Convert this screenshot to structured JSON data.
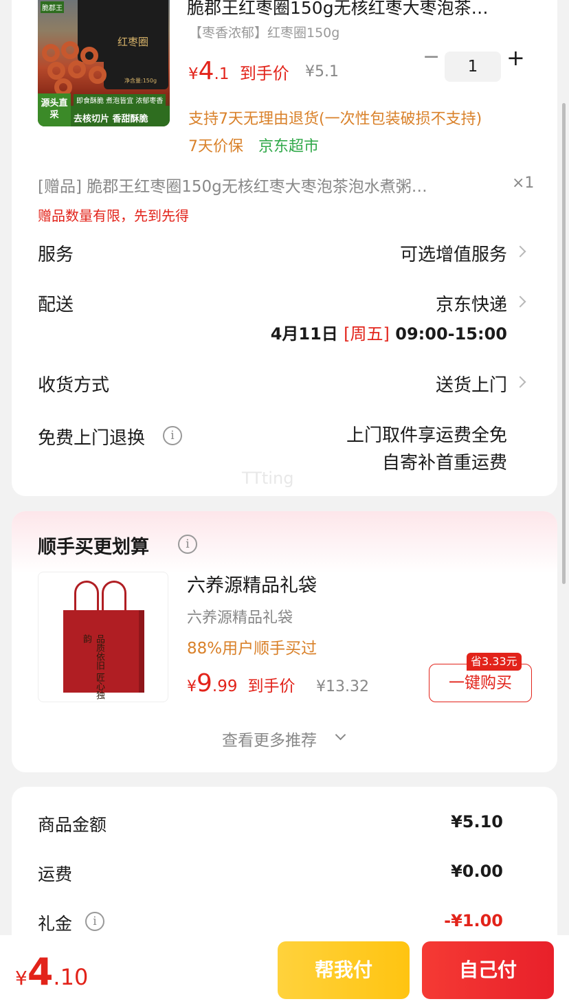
{
  "product": {
    "title": "脆郡王红枣圈150g无核红枣大枣泡茶…",
    "spec": "【枣香浓郁】红枣圈150g",
    "price_symbol": "¥",
    "price_int": "4",
    "price_dec": ".1",
    "price_suffix": "到手价",
    "original_price": "¥5.1",
    "quantity": "1",
    "minus": "−",
    "plus": "+",
    "return_policy": "支持7天无理由退货(一次性包装破损不支持)",
    "price_protect": "7天价保",
    "store_tag": "京东超市",
    "image": {
      "jar_label": "红枣圈",
      "brand": "脆郡王",
      "band_text": "去核切片 香甜酥脆",
      "tag_text": "源头直采",
      "strip_text": "即食酥脆 煮泡皆宜 浓郁枣香",
      "net_weight": "净含量:150g"
    }
  },
  "gift": {
    "text": "[赠品] 脆郡王红枣圈150g无核红枣大枣泡茶泡水煮粥…",
    "count": "×1",
    "notice": "赠品数量有限，先到先得"
  },
  "rows": {
    "service_label": "服务",
    "service_value": "可选增值服务",
    "delivery_label": "配送",
    "delivery_value": "京东快递",
    "delivery_date": "4月11日",
    "delivery_weekday": "[周五]",
    "delivery_time": "09:00-15:00",
    "receive_label": "收货方式",
    "receive_value": "送货上门",
    "return_label": "免费上门退换",
    "return_value_1": "上门取件享运费全免",
    "return_value_2": "自寄补首重运费",
    "info_glyph": "i"
  },
  "watermark": "TTting",
  "bundle": {
    "section_title": "顺手买更划算",
    "item_title": "六养源精品礼袋",
    "item_spec": "六养源精品礼袋",
    "item_stat": "88%用户顺手买过",
    "price_symbol": "¥",
    "price_int": "9",
    "price_dec": ".99",
    "price_suffix": "到手价",
    "original_price": "¥13.32",
    "save_badge": "省3.33元",
    "buy_button": "一键购买",
    "more": "查看更多推荐",
    "bag_text": "品质依旧 匠心独韵"
  },
  "summary": {
    "goods_label": "商品金额",
    "goods_value": "¥5.10",
    "shipping_label": "运费",
    "shipping_value": "¥0.00",
    "gift_label": "礼金",
    "gift_value": "-¥1.00"
  },
  "bottom": {
    "symbol": "¥",
    "total_int": "4",
    "total_dec": ".10",
    "help_pay": "帮我付",
    "self_pay": "自己付"
  }
}
